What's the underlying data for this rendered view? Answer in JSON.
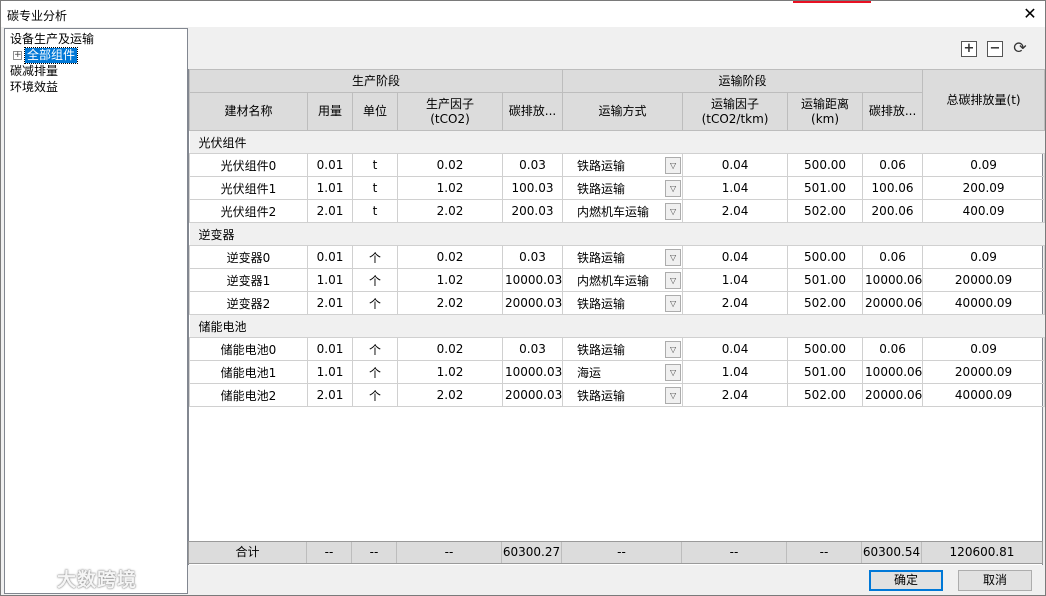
{
  "window": {
    "title": "碳专业分析",
    "close_glyph": "✕",
    "accent_color": "#e81123"
  },
  "tree": {
    "items": [
      {
        "label": "设备生产及运输"
      },
      {
        "label": "碳减排量"
      },
      {
        "label": "环境效益"
      }
    ],
    "child": {
      "label": "全部组件",
      "expander": "+"
    },
    "selection_color": "#0078d7"
  },
  "watermark": {
    "text": "大数跨境"
  },
  "toolbar": {
    "expand_icon": "+",
    "collapse_icon": "−",
    "refresh_icon": "⟳"
  },
  "grid": {
    "group_headers": {
      "production": "生产阶段",
      "transport": "运输阶段",
      "total": "总碳排放量(t)"
    },
    "columns": {
      "name": "建材名称",
      "amount": "用量",
      "unit": "单位",
      "prod_factor": "生产因子\n(tCO2)",
      "prod_emission": "碳排放...",
      "mode": "运输方式",
      "trans_factor": "运输因子\n(tCO2/tkm)",
      "distance": "运输距离\n(km)",
      "trans_emission": "碳排放..."
    },
    "groups": [
      {
        "name": "光伏组件",
        "rows": [
          {
            "name": "光伏组件0",
            "amount": "0.01",
            "unit": "t",
            "pf": "0.02",
            "pe": "0.03",
            "mode": "铁路运输",
            "tf": "0.04",
            "dist": "500.00",
            "te": "0.06",
            "total": "0.09"
          },
          {
            "name": "光伏组件1",
            "amount": "1.01",
            "unit": "t",
            "pf": "1.02",
            "pe": "100.03",
            "mode": "铁路运输",
            "tf": "1.04",
            "dist": "501.00",
            "te": "100.06",
            "total": "200.09"
          },
          {
            "name": "光伏组件2",
            "amount": "2.01",
            "unit": "t",
            "pf": "2.02",
            "pe": "200.03",
            "mode": "内燃机车运输",
            "tf": "2.04",
            "dist": "502.00",
            "te": "200.06",
            "total": "400.09"
          }
        ]
      },
      {
        "name": "逆变器",
        "rows": [
          {
            "name": "逆变器0",
            "amount": "0.01",
            "unit": "个",
            "pf": "0.02",
            "pe": "0.03",
            "mode": "铁路运输",
            "tf": "0.04",
            "dist": "500.00",
            "te": "0.06",
            "total": "0.09"
          },
          {
            "name": "逆变器1",
            "amount": "1.01",
            "unit": "个",
            "pf": "1.02",
            "pe": "10000.03",
            "mode": "内燃机车运输",
            "tf": "1.04",
            "dist": "501.00",
            "te": "10000.06",
            "total": "20000.09"
          },
          {
            "name": "逆变器2",
            "amount": "2.01",
            "unit": "个",
            "pf": "2.02",
            "pe": "20000.03",
            "mode": "铁路运输",
            "tf": "2.04",
            "dist": "502.00",
            "te": "20000.06",
            "total": "40000.09"
          }
        ]
      },
      {
        "name": "储能电池",
        "rows": [
          {
            "name": "储能电池0",
            "amount": "0.01",
            "unit": "个",
            "pf": "0.02",
            "pe": "0.03",
            "mode": "铁路运输",
            "tf": "0.04",
            "dist": "500.00",
            "te": "0.06",
            "total": "0.09"
          },
          {
            "name": "储能电池1",
            "amount": "1.01",
            "unit": "个",
            "pf": "1.02",
            "pe": "10000.03",
            "mode": "海运",
            "tf": "1.04",
            "dist": "501.00",
            "te": "10000.06",
            "total": "20000.09"
          },
          {
            "name": "储能电池2",
            "amount": "2.01",
            "unit": "个",
            "pf": "2.02",
            "pe": "20000.03",
            "mode": "铁路运输",
            "tf": "2.04",
            "dist": "502.00",
            "te": "20000.06",
            "total": "40000.09"
          }
        ]
      }
    ],
    "combo_arrow": "▽"
  },
  "totals": {
    "label": "合计",
    "amount": "--",
    "unit": "--",
    "pf": "--",
    "pe": "60300.27",
    "mode": "--",
    "tf": "--",
    "dist": "--",
    "te": "60300.54",
    "total": "120600.81"
  },
  "buttons": {
    "ok": "确定",
    "cancel": "取消"
  }
}
